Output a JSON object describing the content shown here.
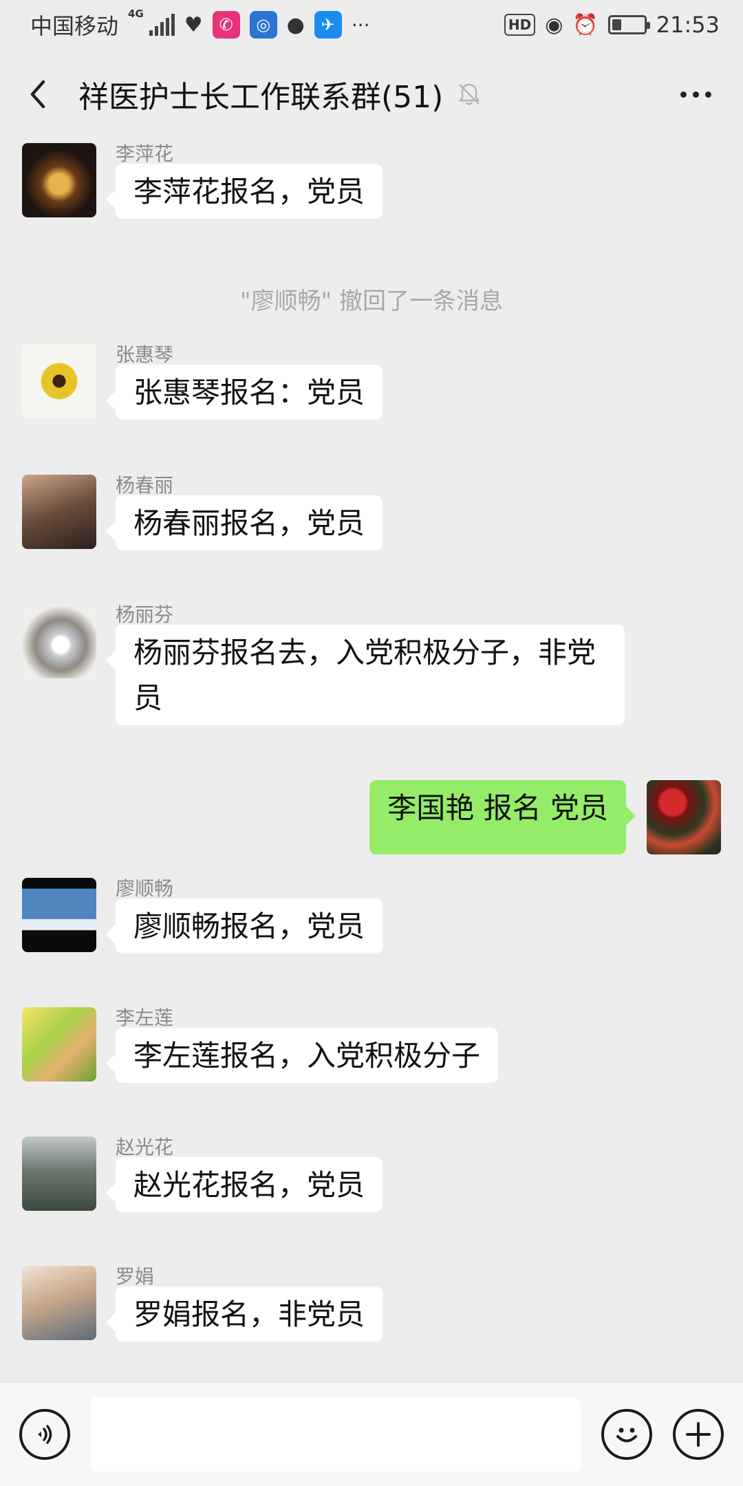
{
  "status_bar": {
    "carrier": "中国移动",
    "network": "4G",
    "time": "21:53",
    "hd_label": "HD",
    "more_dots": "···",
    "battery_level": 0.3
  },
  "header": {
    "title": "祥医护士长工作联系群(51)"
  },
  "messages": [
    {
      "sender": "李萍花",
      "text": "李萍花报名，党员"
    },
    {
      "system": "\"廖顺畅\" 撤回了一条消息"
    },
    {
      "sender": "张惠琴",
      "text": "张惠琴报名：党员"
    },
    {
      "sender": "杨春丽",
      "text": "杨春丽报名，党员"
    },
    {
      "sender": "杨丽芬",
      "text": "杨丽芬报名去，入党积极分子，非党员"
    },
    {
      "self": true,
      "text": "李国艳  报名   党员"
    },
    {
      "sender": "廖顺畅",
      "text": "廖顺畅报名，党员"
    },
    {
      "sender": "李左莲",
      "text": "李左莲报名，入党积极分子"
    },
    {
      "sender": "赵光花",
      "text": "赵光花报名，党员"
    },
    {
      "sender": "罗娟",
      "text": "罗娟报名，非党员"
    }
  ],
  "input_bar": {
    "placeholder": ""
  }
}
